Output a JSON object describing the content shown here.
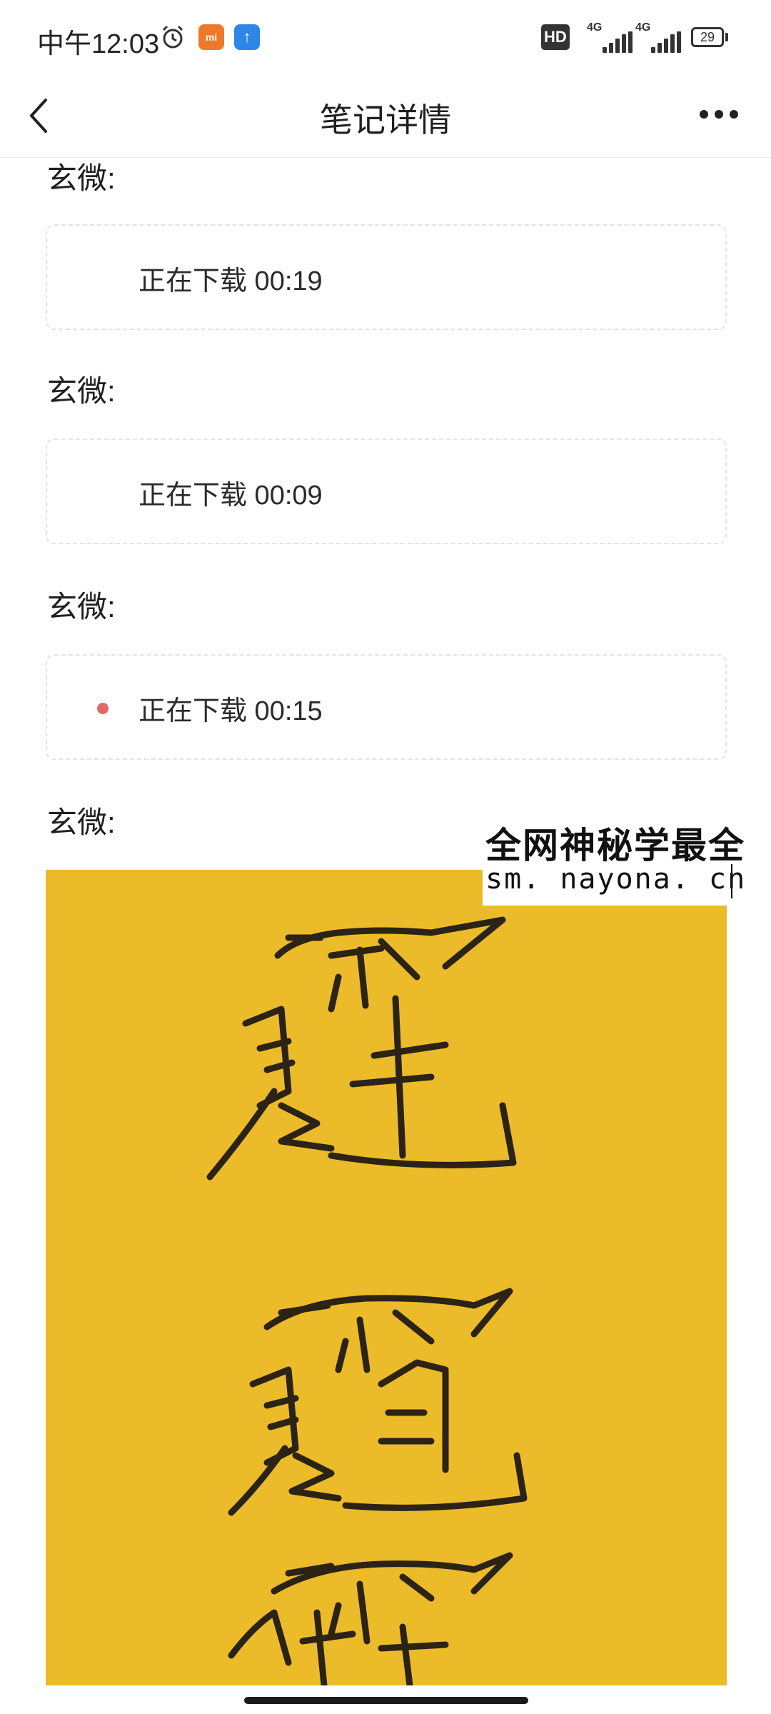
{
  "status_bar": {
    "time": "中午12:03",
    "hd_label": "HD",
    "signal1_label": "4G",
    "signal2_label": "4G",
    "battery": "29",
    "icons": [
      "alarm-icon",
      "mi-app-icon",
      "upload-app-icon"
    ]
  },
  "header": {
    "title": "笔记详情",
    "back_icon": "chevron-left-icon",
    "more_icon": "more-horizontal-icon"
  },
  "notes": [
    {
      "speaker": "玄微:",
      "audio_label": "正在下载 00:19",
      "recording_dot": false
    },
    {
      "speaker": "玄微:",
      "audio_label": "正在下载 00:09",
      "recording_dot": false
    },
    {
      "speaker": "玄微:",
      "audio_label": "正在下载 00:15",
      "recording_dot": true
    },
    {
      "speaker": "玄微:"
    }
  ],
  "watermark": {
    "line1": "全网神秘学最全",
    "line2": "sm. nayona. cn"
  },
  "image": {
    "description_icon": "talisman-image",
    "background_color": "#ecbb2a"
  },
  "colors": {
    "recording_dot": "#e06b64",
    "card_border": "#e3e3e3"
  }
}
